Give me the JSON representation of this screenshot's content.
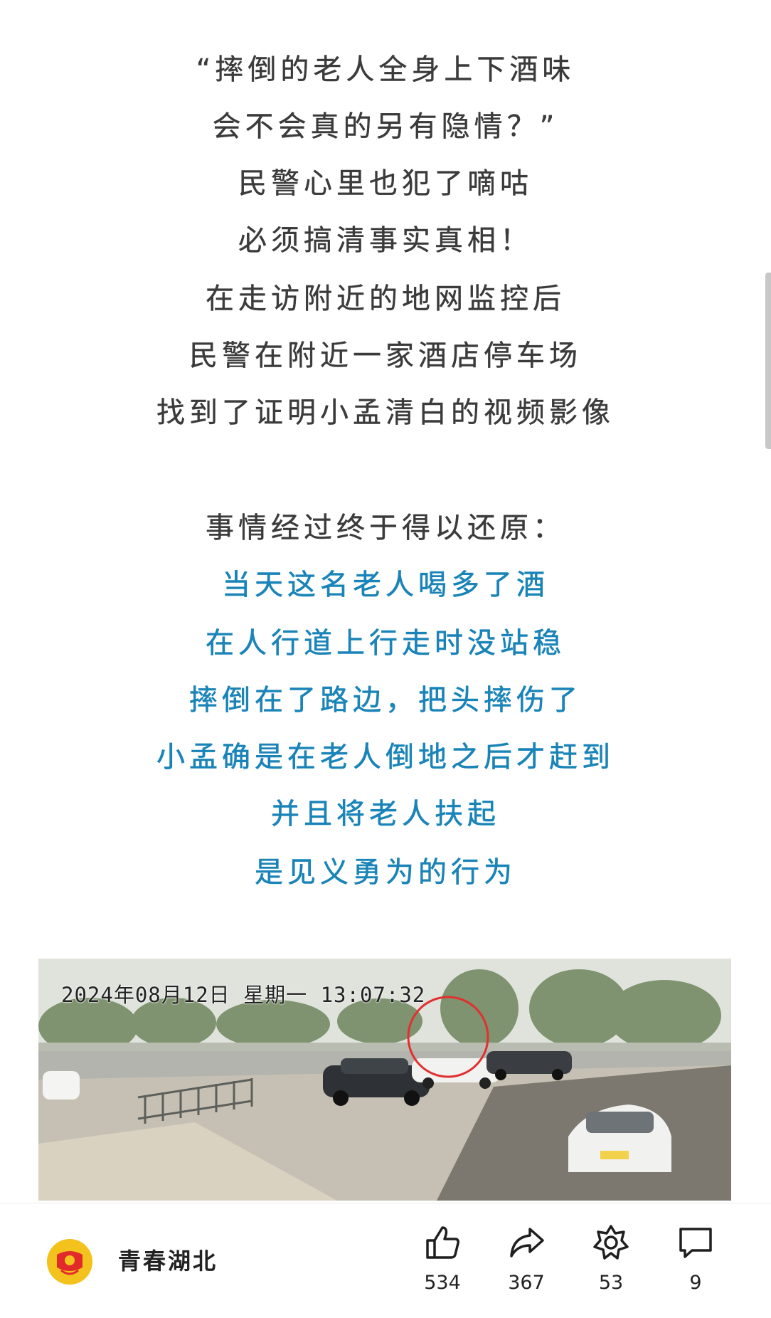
{
  "article": {
    "lines": [
      "“摔倒的老人全身上下酒味",
      "会不会真的另有隐情？”",
      "民警心里也犯了嘀咕",
      "必须搞清事实真相！",
      "在走访附近的地网监控后",
      "民警在附近一家酒店停车场",
      "找到了证明小孟清白的视频影像",
      "事情经过终于得以还原：",
      "当天这名老人喝多了酒",
      "在人行道上行走时没站稳",
      "摔倒在了路边，把头摔伤了",
      "小孟确是在老人倒地之后才赶到",
      "并且将老人扶起",
      "是见义勇为的行为"
    ],
    "highlight_color": "#1a84b8",
    "text_color": "#3b3b3b"
  },
  "video": {
    "timestamp": "2024年08月12日  星期一  13:07:32"
  },
  "bottom_bar": {
    "account_name": "青春湖北",
    "avatar_icon": "youth-league-emblem-icon",
    "actions": [
      {
        "name": "like",
        "icon": "thumbs-up-icon",
        "count": "534"
      },
      {
        "name": "share",
        "icon": "share-arrow-icon",
        "count": "367"
      },
      {
        "name": "favorite",
        "icon": "star-outline-icon",
        "count": "53"
      },
      {
        "name": "comment",
        "icon": "comment-bubble-icon",
        "count": "9"
      }
    ]
  }
}
